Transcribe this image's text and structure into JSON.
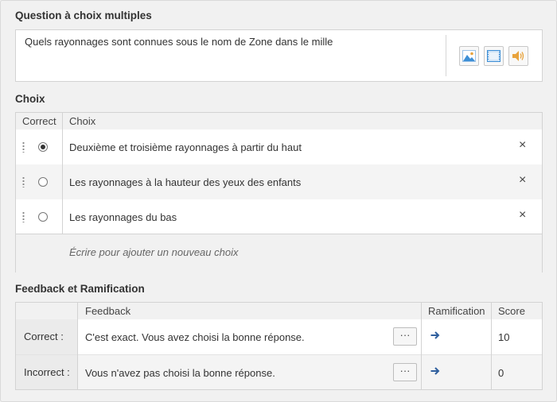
{
  "question_section": {
    "title": "Question à choix multiples",
    "text": "Quels rayonnages sont connues sous le nom  de Zone dans le mille",
    "media_buttons": [
      "image-icon",
      "video-icon",
      "audio-icon"
    ]
  },
  "choices_section": {
    "title": "Choix",
    "headers": {
      "correct": "Correct",
      "choice": "Choix"
    },
    "items": [
      {
        "label": "Deuxième et troisième rayonnages à partir du haut",
        "selected": true,
        "delete": "×"
      },
      {
        "label": "Les rayonnages à la hauteur des yeux des enfants",
        "selected": false,
        "delete": "×"
      },
      {
        "label": "Les rayonnages du bas",
        "selected": false,
        "delete": "×"
      }
    ],
    "add_placeholder": "Écrire pour ajouter un nouveau choix"
  },
  "feedback_section": {
    "title": "Feedback et Ramification",
    "headers": {
      "feedback": "Feedback",
      "branching": "Ramification",
      "score": "Score"
    },
    "rows": [
      {
        "label": "Correct :",
        "feedback": "C'est exact. Vous avez choisi la bonne réponse.",
        "more": "···",
        "score": "10"
      },
      {
        "label": "Incorrect :",
        "feedback": "Vous n'avez pas choisi la bonne réponse.",
        "more": "···",
        "score": "0"
      }
    ]
  },
  "colors": {
    "accent_arrow": "#2f5f9e",
    "media_icon_blue": "#3d8fd6",
    "media_icon_orange": "#e8a33d"
  }
}
